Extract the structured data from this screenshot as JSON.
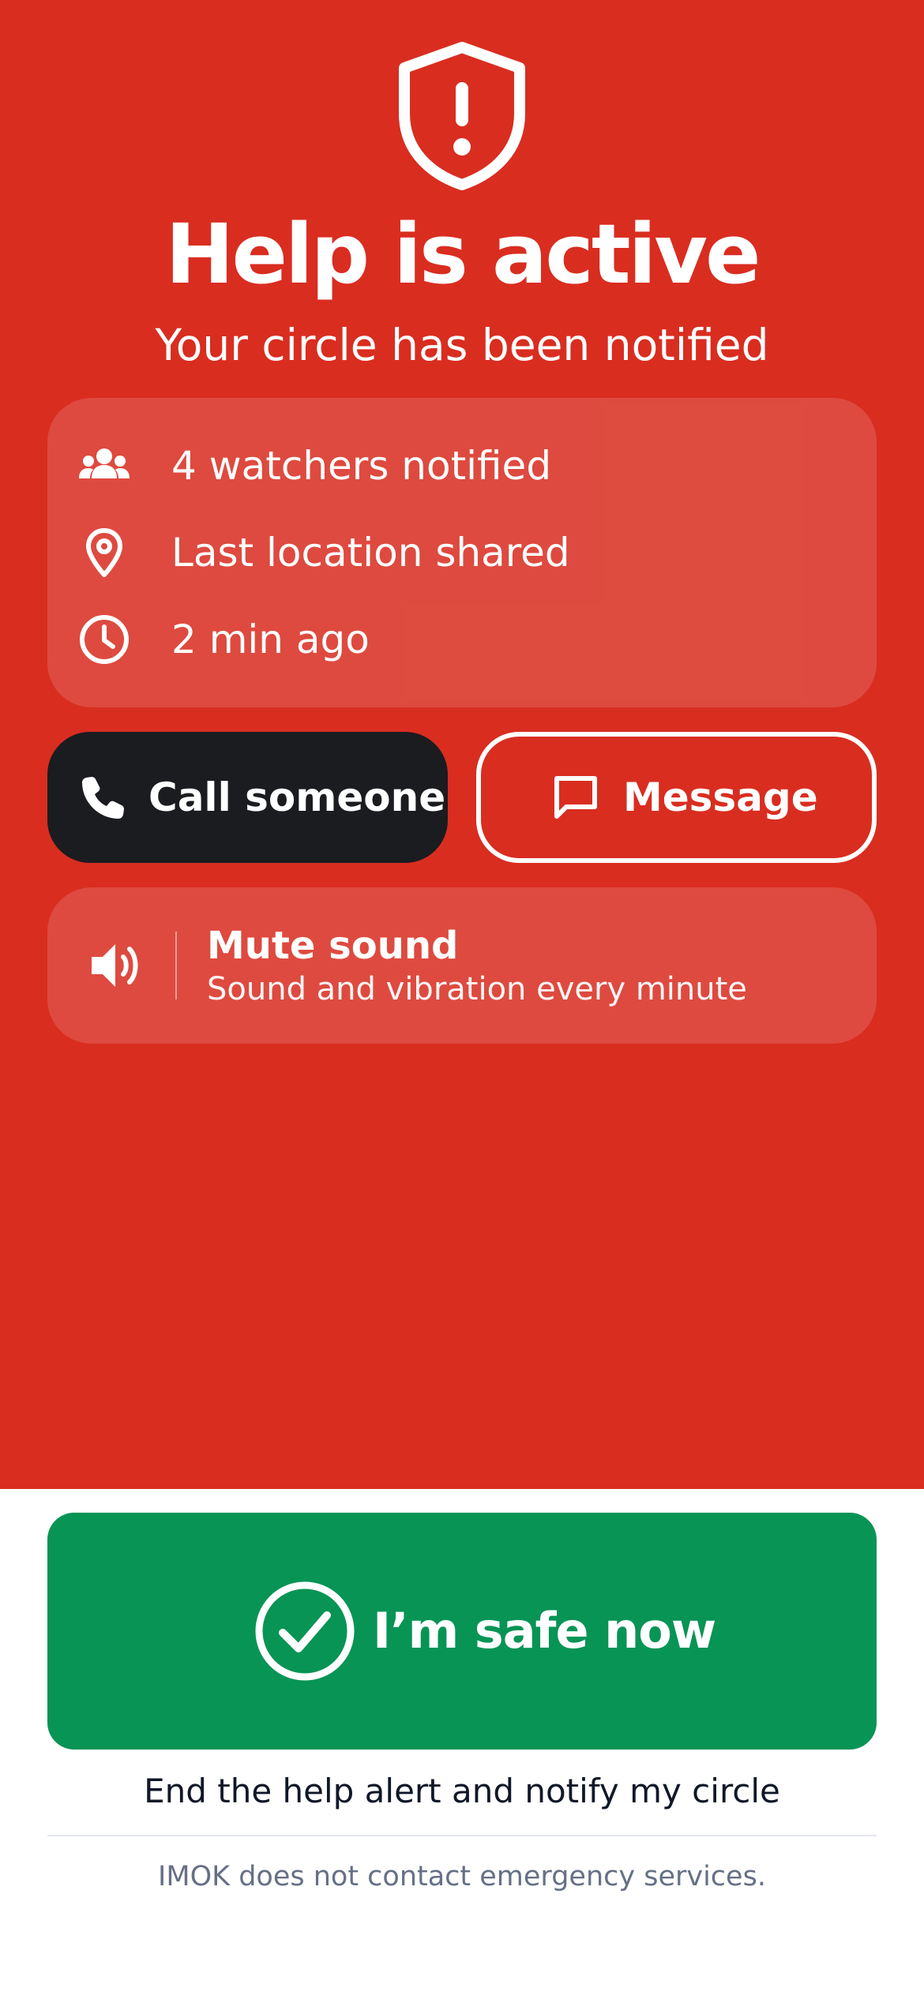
{
  "colors": {
    "alert_red": "#D92D20",
    "safe_green": "#079455",
    "dark_button": "#1A1C20",
    "white": "#FFFFFF"
  },
  "header": {
    "icon": "shield-alert-icon",
    "title": "Help is active",
    "subtitle": "Your circle has been notified"
  },
  "status": {
    "items": [
      {
        "icon": "people-icon",
        "label": "4 watchers notified"
      },
      {
        "icon": "location-pin-icon",
        "label": "Last location shared"
      },
      {
        "icon": "clock-icon",
        "label": "2 min ago"
      }
    ]
  },
  "actions": {
    "call": {
      "icon": "phone-icon",
      "label": "Call someone"
    },
    "message": {
      "icon": "message-icon",
      "label": "Message"
    }
  },
  "sound": {
    "icon": "speaker-icon",
    "title": "Mute sound",
    "subtitle": "Sound and vibration every minute"
  },
  "safe": {
    "icon": "check-circle-icon",
    "label": "I’m safe now",
    "caption": "End the help alert and notify my circle"
  },
  "footer": {
    "disclaimer": "IMOK does not contact emergency services."
  }
}
